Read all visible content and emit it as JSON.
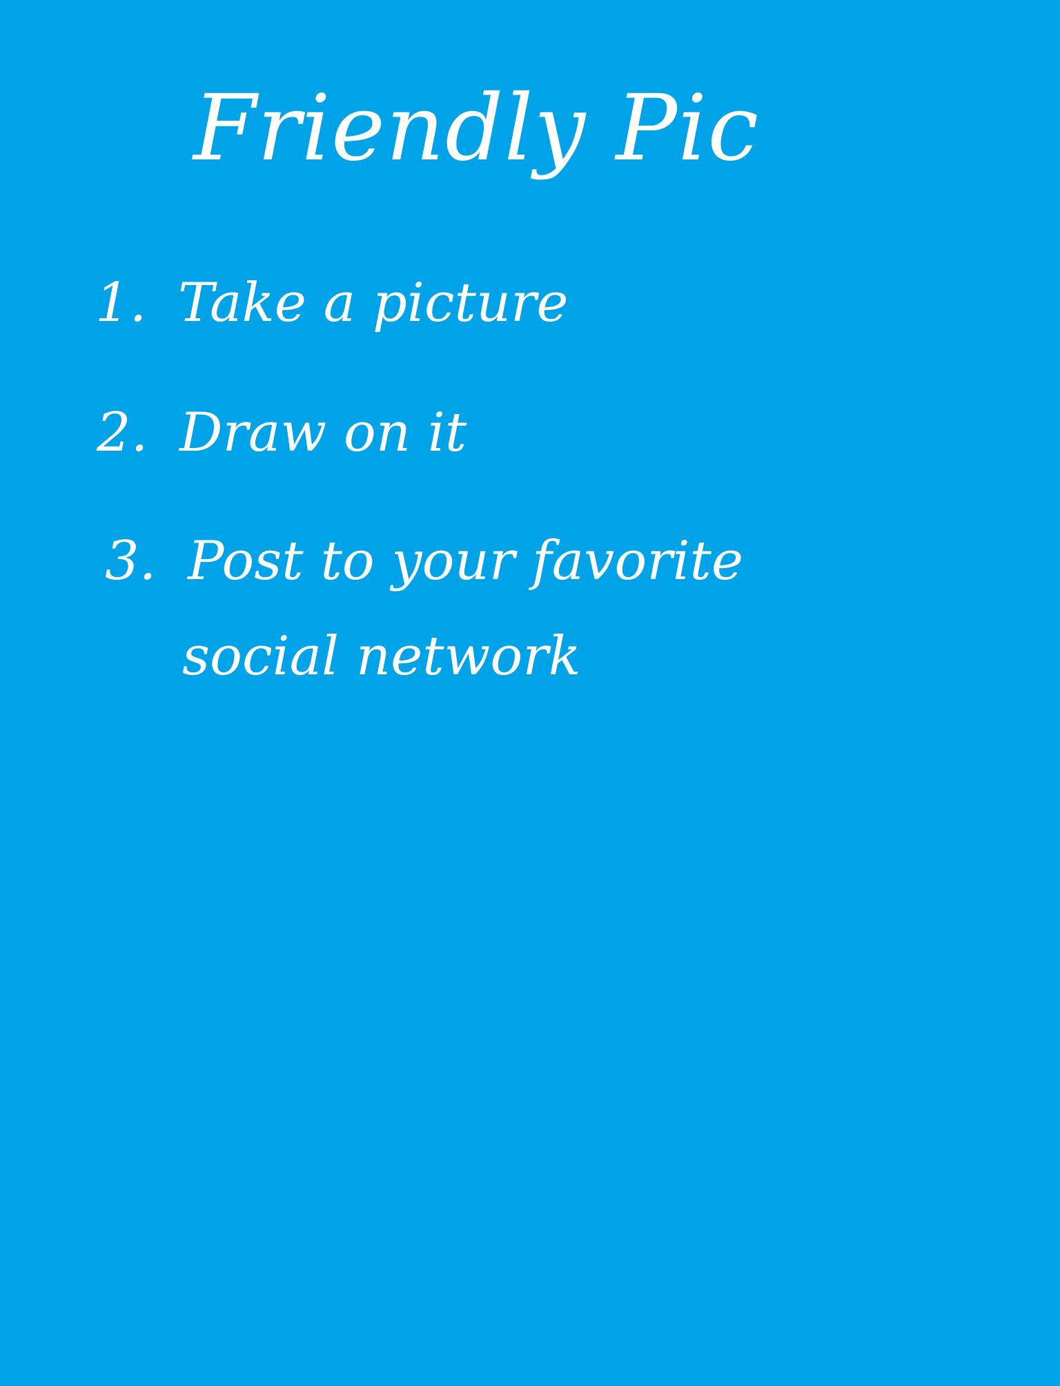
{
  "app": {
    "title": "Friendly Pic",
    "background_color": "#00a2e8",
    "text_color": "#ffffff"
  },
  "steps": [
    {
      "number": "1.",
      "text": "Take a picture"
    },
    {
      "number": "2.",
      "text": "Draw on it"
    },
    {
      "number": "3.",
      "text": "Post to your favorite",
      "continuation": "social network"
    }
  ]
}
